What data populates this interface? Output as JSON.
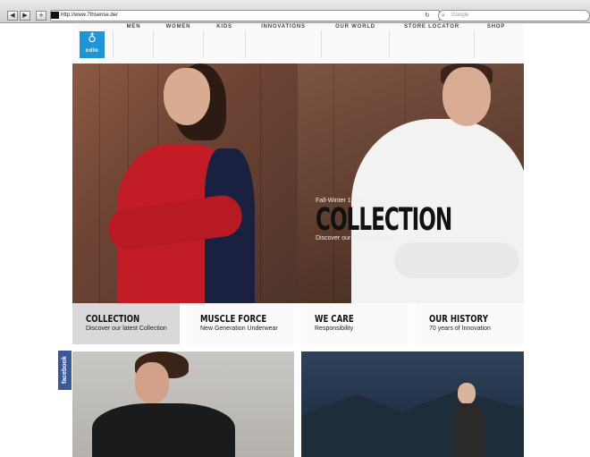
{
  "browser": {
    "url": "http://www.7thsense.de/",
    "search_placeholder": "Google",
    "back_label": "◀",
    "forward_label": "▶",
    "add_label": "+"
  },
  "site": {
    "brand": "odlo",
    "nav": [
      "MEN",
      "WOMEN",
      "KIDS",
      "INNOVATIONS",
      "OUR WORLD",
      "STORE LOCATOR",
      "SHOP"
    ],
    "hero": {
      "season": "Fall-Winter 13/14",
      "title": "COLLECTION",
      "subtitle": "Discover our latest collection"
    },
    "teasers": [
      {
        "title": "COLLECTION",
        "subtitle": "Discover our latest Collection"
      },
      {
        "title": "MUSCLE FORCE",
        "subtitle": "New Generation Underwear"
      },
      {
        "title": "WE CARE",
        "subtitle": "Responsibility"
      },
      {
        "title": "OUR HISTORY",
        "subtitle": "70 years of Innovation"
      }
    ],
    "social_tab": "facebook"
  },
  "colors": {
    "brand_blue": "#1f95d6",
    "facebook_blue": "#3b5998",
    "active_teaser": "#d9d9d9"
  }
}
